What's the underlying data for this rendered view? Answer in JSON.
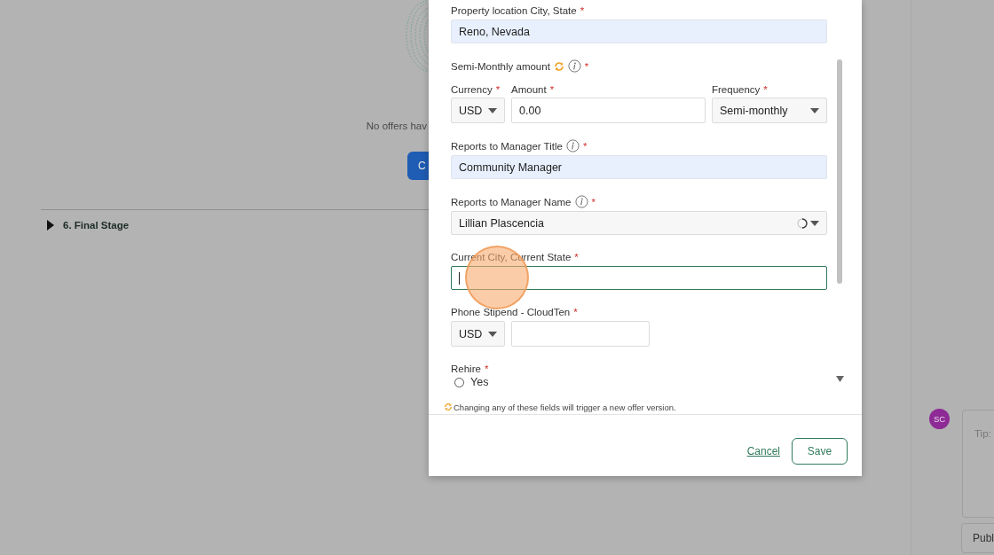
{
  "background": {
    "empty_message": "No offers hav",
    "create_button": "C",
    "stage": {
      "label": "6. Final Stage",
      "expanded": false
    }
  },
  "side_panel": {
    "avatar": "SC",
    "comment_placeholder": "Tip:",
    "publish_button": "Publ"
  },
  "dialog": {
    "fields": [
      {
        "kind": "text",
        "label": "Property location City, State",
        "required_mark": "*",
        "value": "Reno, Nevada",
        "autofilled": true
      },
      {
        "kind": "group",
        "label": "Semi-Monthly amount",
        "triggers_version": true,
        "info": true,
        "required_mark": "*",
        "parts": [
          {
            "kind": "select",
            "label": "Currency",
            "required_mark": "*",
            "value": "USD"
          },
          {
            "kind": "text",
            "label": "Amount",
            "required_mark": "*",
            "value": "0.00"
          },
          {
            "kind": "select",
            "label": "Frequency",
            "required_mark": "*",
            "value": "Semi-monthly"
          }
        ]
      },
      {
        "kind": "text",
        "label": "Reports to Manager Title",
        "info": true,
        "required_mark": "*",
        "value": "Community Manager",
        "autofilled": true
      },
      {
        "kind": "lookup",
        "label": "Reports to Manager Name",
        "info": true,
        "required_mark": "*",
        "value": "Lillian Plascencia",
        "loading": true
      },
      {
        "kind": "text",
        "label": "Current City, Current State",
        "required_mark": "*",
        "focused": true
      },
      {
        "kind": "group",
        "label": "Phone Stipend - CloudTen",
        "required_mark": "*",
        "parts": [
          {
            "kind": "select",
            "value": "USD"
          },
          {
            "kind": "text"
          }
        ]
      },
      {
        "kind": "radio",
        "label": "Rehire",
        "required_mark": "*",
        "options": [
          {
            "label": "Yes",
            "selected": false
          }
        ]
      }
    ],
    "note": "Changing any of these fields will trigger a new offer version.",
    "buttons": [
      {
        "label": "Cancel",
        "kind": "link"
      },
      {
        "label": "Save",
        "kind": "outline"
      }
    ]
  }
}
